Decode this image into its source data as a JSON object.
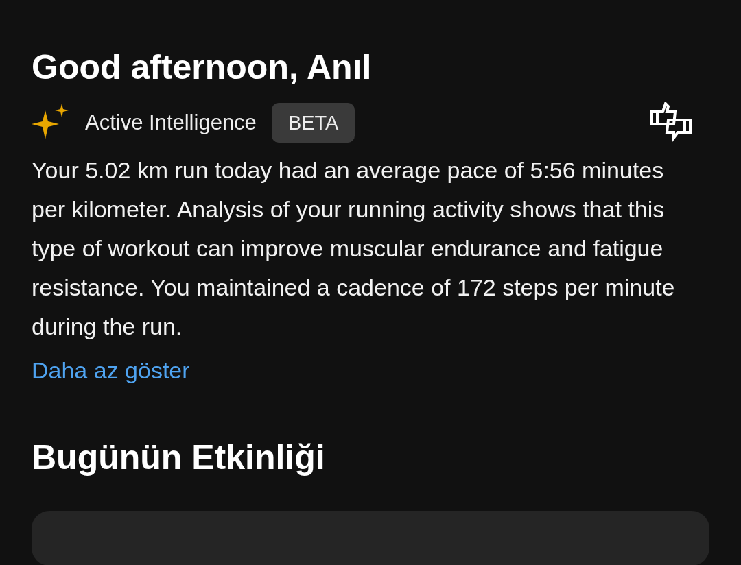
{
  "greeting": "Good afternoon, Anıl",
  "insight": {
    "title": "Active Intelligence",
    "badge": "BETA",
    "text": "Your 5.02 km run today had an average pace of 5:56 minutes per kilometer. Analysis of your running activity shows that this type of workout can improve muscular endurance and fatigue resistance. You maintained a cadence of 172 steps per minute during the run.",
    "link": "Daha az göster"
  },
  "section_title": "Bugünün Etkinliği"
}
